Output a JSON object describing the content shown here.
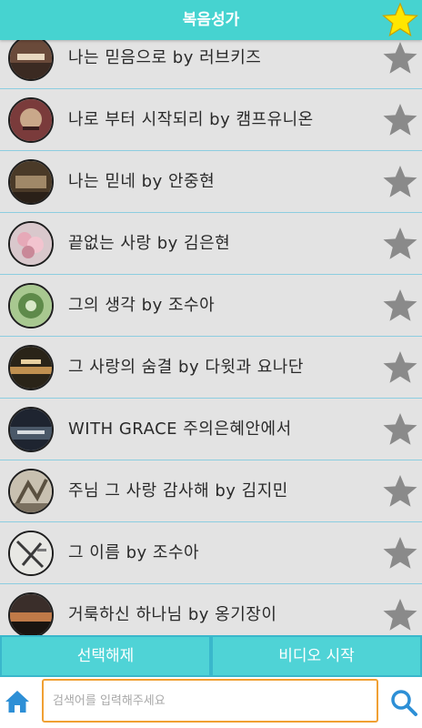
{
  "header": {
    "title": "복음성가",
    "favorite_icon": "star-icon"
  },
  "colors": {
    "header": "#46d3d0",
    "star_active": "#ffe600",
    "star_inactive": "#8a8a8a",
    "accent_orange": "#f0a033",
    "divider": "#8ccde0"
  },
  "songs": [
    {
      "title": "나는 믿음으로 by 러브키즈"
    },
    {
      "title": "나로 부터 시작되리 by 캠프유니온"
    },
    {
      "title": "나는 믿네 by 안중현"
    },
    {
      "title": "끝없는 사랑 by 김은현"
    },
    {
      "title": "그의 생각 by 조수아"
    },
    {
      "title": "그 사랑의 숨결 by 다윗과 요나단"
    },
    {
      "title": "WITH GRACE 주의은혜안에서"
    },
    {
      "title": "주님 그 사랑 감사해 by 김지민"
    },
    {
      "title": "그 이름 by 조수아"
    },
    {
      "title": "거룩하신 하나님 by 옹기장이"
    }
  ],
  "buttons": {
    "deselect": "선택해제",
    "start_video": "비디오 시작"
  },
  "search": {
    "placeholder": "검색어를 입력해주세요",
    "value": ""
  }
}
